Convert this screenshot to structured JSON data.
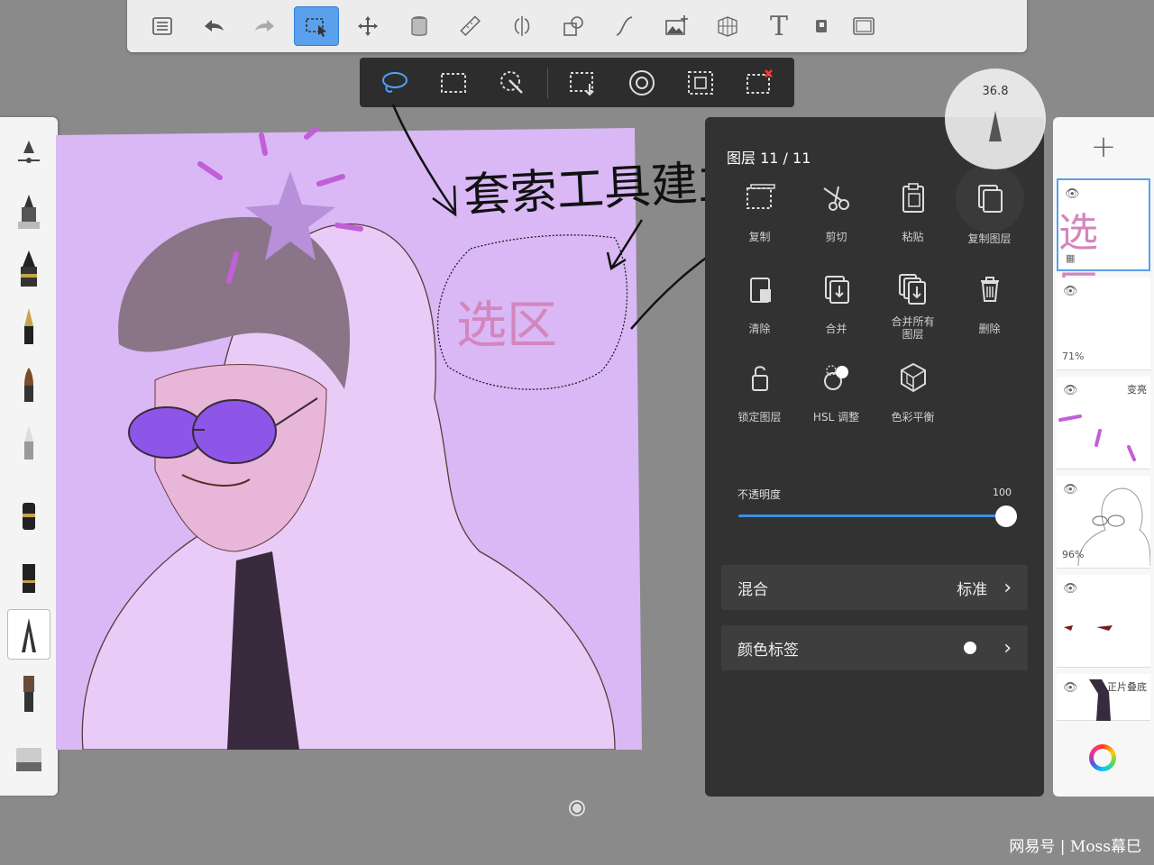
{
  "top_toolbar": {
    "tools": [
      {
        "name": "layers-list-icon"
      },
      {
        "name": "undo-icon"
      },
      {
        "name": "redo-icon"
      },
      {
        "name": "selection-icon",
        "active": true
      },
      {
        "name": "transform-icon"
      },
      {
        "name": "fill-bucket-icon"
      },
      {
        "name": "ruler-icon"
      },
      {
        "name": "symmetry-icon"
      },
      {
        "name": "shape-icon"
      },
      {
        "name": "curve-icon"
      },
      {
        "name": "add-image-icon"
      },
      {
        "name": "perspective-grid-icon"
      },
      {
        "name": "text-icon"
      },
      {
        "name": "flipbook-icon"
      },
      {
        "name": "fullscreen-icon"
      }
    ],
    "text_tool_glyph": "T"
  },
  "selection_toolbar": {
    "tools": [
      {
        "name": "lasso-select-icon",
        "active": true
      },
      {
        "name": "rect-select-icon"
      },
      {
        "name": "magic-wand-icon"
      },
      {
        "name": "selection-transform-icon"
      },
      {
        "name": "selection-feather-icon"
      },
      {
        "name": "select-all-icon"
      },
      {
        "name": "clear-selection-icon"
      }
    ]
  },
  "canvas": {
    "background": "#d9b8f5",
    "handwriting_note": "套索工具建立",
    "selection_label": "选区"
  },
  "layer_panel": {
    "title": "图层 11 / 11",
    "actions": [
      {
        "label": "复制",
        "icon": "copy-selection-icon"
      },
      {
        "label": "剪切",
        "icon": "scissors-icon"
      },
      {
        "label": "粘贴",
        "icon": "paste-icon"
      },
      {
        "label": "复制图层",
        "icon": "duplicate-layer-icon"
      },
      {
        "label": "清除",
        "icon": "clear-layer-icon"
      },
      {
        "label": "合并",
        "icon": "merge-down-icon"
      },
      {
        "label": "合并所有\n图层",
        "icon": "merge-all-icon"
      },
      {
        "label": "删除",
        "icon": "trash-icon"
      },
      {
        "label": "锁定图层",
        "icon": "lock-icon"
      },
      {
        "label": "HSL 调整",
        "icon": "hsl-icon"
      },
      {
        "label": "色彩平衡",
        "icon": "color-balance-icon"
      }
    ],
    "opacity_label": "不透明度",
    "opacity_value": "100",
    "blend_label": "混合",
    "blend_value": "标准",
    "color_tag_label": "颜色标签"
  },
  "brush_puck": {
    "size": "36.8"
  },
  "layers": {
    "add_label": "+",
    "items": [
      {
        "name": "selection-layer",
        "pct": "",
        "mode": "",
        "active": true,
        "preview_text": "选区"
      },
      {
        "name": "layer-2",
        "pct": "71%",
        "mode": ""
      },
      {
        "name": "layer-3",
        "pct": "",
        "mode": "变亮"
      },
      {
        "name": "layer-4",
        "pct": "96%",
        "mode": ""
      },
      {
        "name": "layer-5",
        "pct": "",
        "mode": ""
      },
      {
        "name": "layer-6",
        "pct": "",
        "mode": "正片叠底"
      }
    ]
  },
  "watermark": "网易号 | Moss幕巳",
  "colors": {
    "accent": "#5aa0ec",
    "panel_dark": "#323232",
    "canvas_bg": "#d9b8f5",
    "slider_blue": "#3a8fe5"
  }
}
